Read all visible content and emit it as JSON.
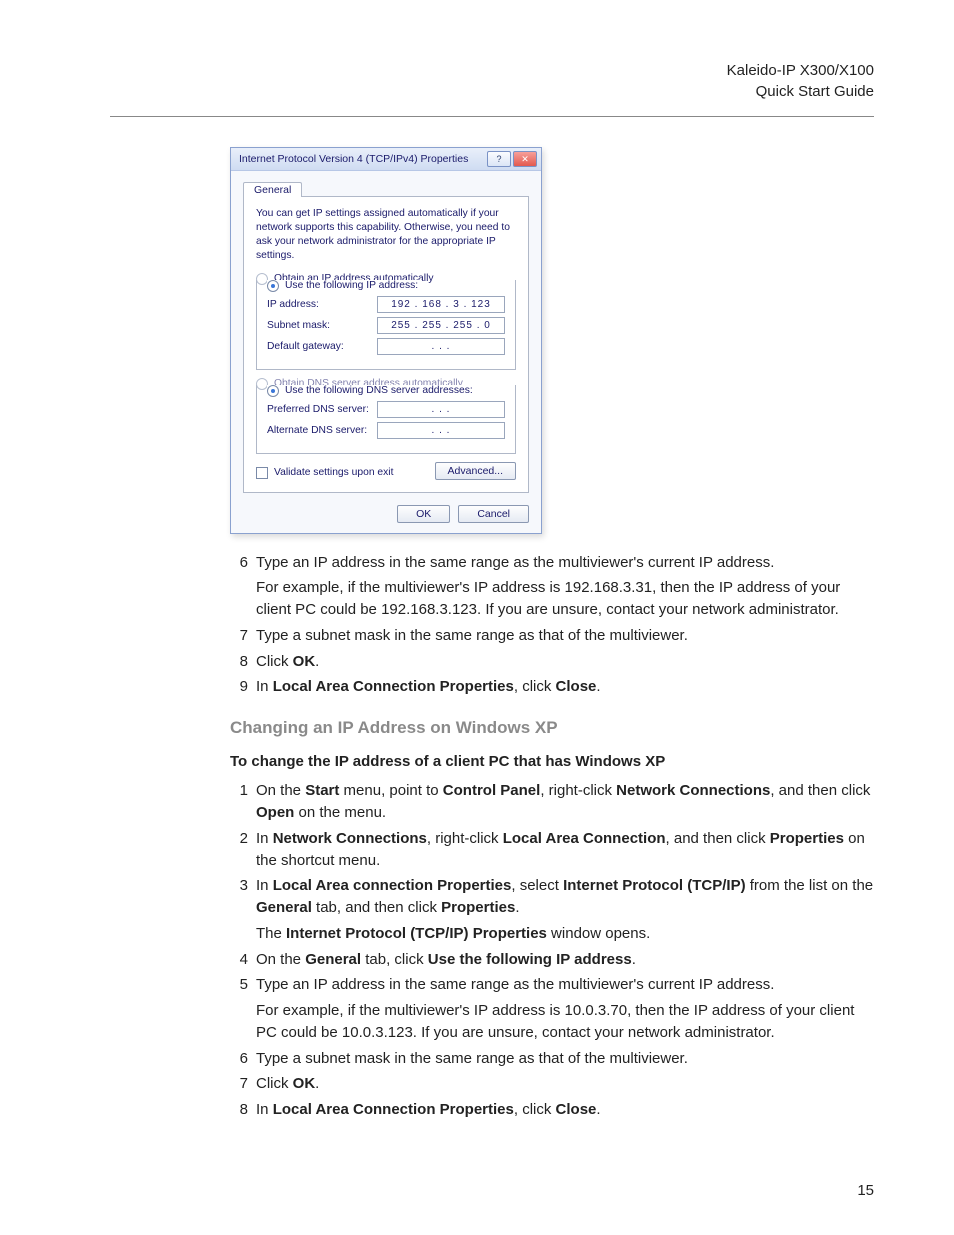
{
  "header": {
    "product": "Kaleido-IP X300/X100",
    "doc": "Quick Start Guide"
  },
  "dialog": {
    "title": "Internet Protocol Version 4 (TCP/IPv4) Properties",
    "helpGlyph": "?",
    "closeGlyph": "✕",
    "tab": "General",
    "intro": "You can get IP settings assigned automatically if your network supports this capability. Otherwise, you need to ask your network administrator for the appropriate IP settings.",
    "opt_auto_ip": "Obtain an IP address automatically",
    "opt_manual_ip": "Use the following IP address:",
    "lbl_ip": "IP address:",
    "lbl_subnet": "Subnet mask:",
    "lbl_gateway": "Default gateway:",
    "ip_value": "192 . 168 .  3  . 123",
    "subnet_value": "255 . 255 . 255 .  0",
    "gateway_value": ".       .       .",
    "opt_auto_dns": "Obtain DNS server address automatically",
    "opt_manual_dns": "Use the following DNS server addresses:",
    "lbl_pref_dns": "Preferred DNS server:",
    "lbl_alt_dns": "Alternate DNS server:",
    "pref_dns_value": ".       .       .",
    "alt_dns_value": ".       .       .",
    "chk_validate": "Validate settings upon exit",
    "btn_advanced": "Advanced...",
    "btn_ok": "OK",
    "btn_cancel": "Cancel"
  },
  "stepsA": {
    "s6n": "6",
    "s6": "Type an IP address in the same range as the multiviewer's current IP address.",
    "s6b": "For example, if the multiviewer's IP address is 192.168.3.31, then the IP address of your client PC could be 192.168.3.123. If you are unsure, contact your network administrator.",
    "s7n": "7",
    "s7": "Type a subnet mask in the same range as that of the multiviewer.",
    "s8n": "8",
    "s8a": "Click ",
    "s8b": "OK",
    "s8c": ".",
    "s9n": "9",
    "s9a": "In ",
    "s9b": "Local Area Connection Properties",
    "s9c": ", click ",
    "s9d": "Close",
    "s9e": "."
  },
  "subhead": "Changing an IP Address on Windows XP",
  "procTitle": "To change the IP address of a client PC that has Windows XP",
  "stepsB": {
    "s1n": "1",
    "s1a": "On the ",
    "s1b": "Start",
    "s1c": " menu, point to ",
    "s1d": "Control Panel",
    "s1e": ", right-click ",
    "s1f": "Network Connections",
    "s1g": ", and then click ",
    "s1h": "Open",
    "s1i": " on the menu.",
    "s2n": "2",
    "s2a": "In ",
    "s2b": "Network Connections",
    "s2c": ", right-click ",
    "s2d": "Local Area Connection",
    "s2e": ", and then click ",
    "s2f": "Properties",
    "s2g": " on the shortcut menu.",
    "s3n": "3",
    "s3a": "In ",
    "s3b": "Local Area connection Properties",
    "s3c": ", select ",
    "s3d": "Internet Protocol (TCP/IP)",
    "s3e": " from the list on the ",
    "s3f": "General",
    "s3g": " tab, and then click ",
    "s3h": "Properties",
    "s3i": ".",
    "s3j": "The ",
    "s3k": "Internet Protocol (TCP/IP) Properties",
    "s3l": " window opens.",
    "s4n": "4",
    "s4a": "On the ",
    "s4b": "General",
    "s4c": " tab, click ",
    "s4d": "Use the following IP address",
    "s4e": ".",
    "s5n": "5",
    "s5": "Type an IP address in the same range as the multiviewer's current IP address.",
    "s5b": "For example, if the multiviewer's IP address is 10.0.3.70, then the IP address of your client PC could be 10.0.3.123. If you are unsure, contact your network administrator.",
    "s6n": "6",
    "s6": "Type a subnet mask in the same range as that of the multiviewer.",
    "s7n": "7",
    "s7a": "Click ",
    "s7b": "OK",
    "s7c": ".",
    "s8n": "8",
    "s8a": "In ",
    "s8b": "Local Area Connection Properties",
    "s8c": ", click ",
    "s8d": "Close",
    "s8e": "."
  },
  "pageNumber": "15"
}
